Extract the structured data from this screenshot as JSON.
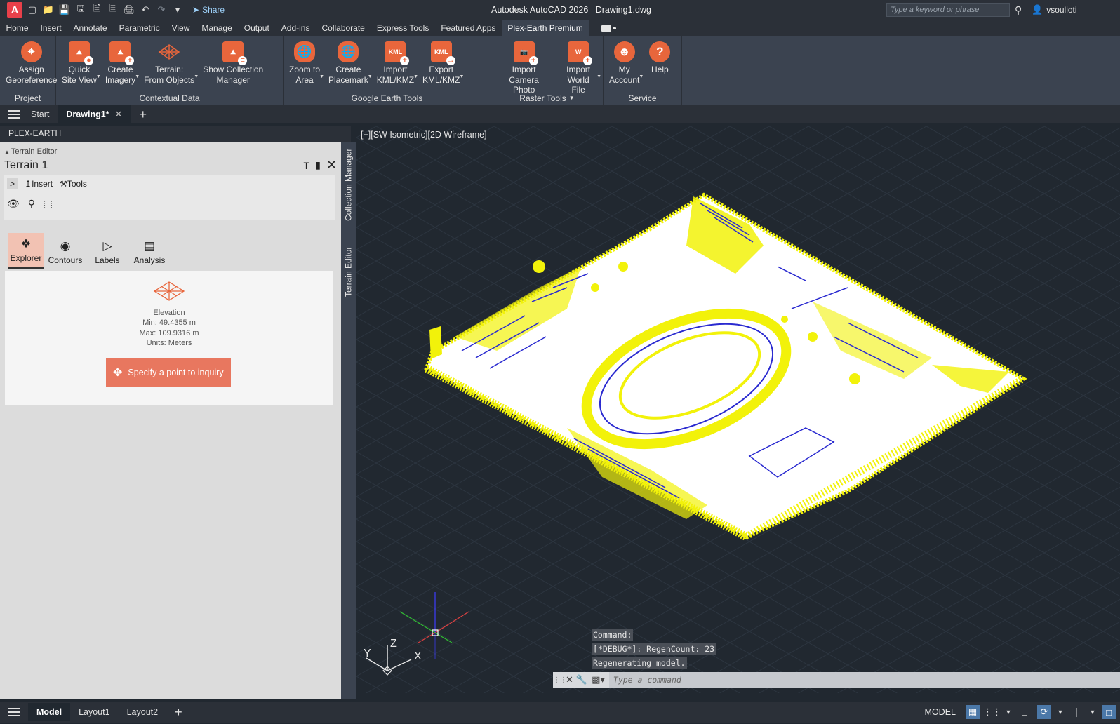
{
  "app": {
    "title": "Autodesk AutoCAD 2026",
    "document": "Drawing1.dwg",
    "logo_letter": "A"
  },
  "qat": {
    "share_label": "Share"
  },
  "search": {
    "placeholder": "Type a keyword or phrase"
  },
  "user": {
    "name": "vsoulioti"
  },
  "ribbon_tabs": [
    "Home",
    "Insert",
    "Annotate",
    "Parametric",
    "View",
    "Manage",
    "Output",
    "Add-ins",
    "Collaborate",
    "Express Tools",
    "Featured Apps",
    "Plex-Earth Premium"
  ],
  "ribbon": {
    "groups": [
      {
        "label": "Project",
        "buttons": [
          {
            "label": "Assign\nGeoreference"
          }
        ]
      },
      {
        "label": "Contextual Data",
        "buttons": [
          {
            "label": "Quick\nSite View"
          },
          {
            "label": "Create\nImagery"
          },
          {
            "label": "Terrain:\nFrom Objects"
          },
          {
            "label": "Show Collection\nManager"
          }
        ]
      },
      {
        "label": "Google Earth Tools",
        "buttons": [
          {
            "label": "Zoom to\nArea"
          },
          {
            "label": "Create\nPlacemark"
          },
          {
            "label": "Import\nKML/KMZ"
          },
          {
            "label": "Export\nKML/KMZ"
          }
        ]
      },
      {
        "label": "Raster Tools",
        "buttons": [
          {
            "label": "Import\nCamera Photo"
          },
          {
            "label": "Import\nWorld File"
          }
        ]
      },
      {
        "label": "Service",
        "buttons": [
          {
            "label": "My\nAccount"
          },
          {
            "label": "Help"
          }
        ]
      }
    ],
    "kml_text": "KML"
  },
  "file_tabs": {
    "start": "Start",
    "drawing": "Drawing1*"
  },
  "palette": {
    "header": "PLEX-EARTH",
    "editor_label": "Terrain Editor",
    "terrain_name": "Terrain 1",
    "toolbar": {
      "insert": "Insert",
      "tools": "Tools"
    },
    "tabs": [
      "Explorer",
      "Contours",
      "Labels",
      "Analysis"
    ],
    "elevation": {
      "title": "Elevation",
      "min": "Min: 49.4355 m",
      "max": "Max: 109.9316 m",
      "units": "Units: Meters"
    },
    "inquiry_button": "Specify a point to inquiry",
    "side_tabs": [
      "Collection Manager",
      "Terrain Editor"
    ]
  },
  "viewport": {
    "label": "[−][SW Isometric][2D Wireframe]"
  },
  "command": {
    "history": [
      "Command:",
      "[*DEBUG*]: RegenCount: 23",
      "Regenerating model."
    ],
    "placeholder": "Type a command"
  },
  "ucs": {
    "x": "X",
    "y": "Y",
    "z": "Z"
  },
  "status": {
    "layouts": [
      "Model",
      "Layout1",
      "Layout2"
    ],
    "model_label": "MODEL"
  },
  "colors": {
    "accent": "#e8663c",
    "terrain_yellow": "#f2f20a",
    "terrain_blue": "#2020d8",
    "viewport_bg": "#212830"
  }
}
